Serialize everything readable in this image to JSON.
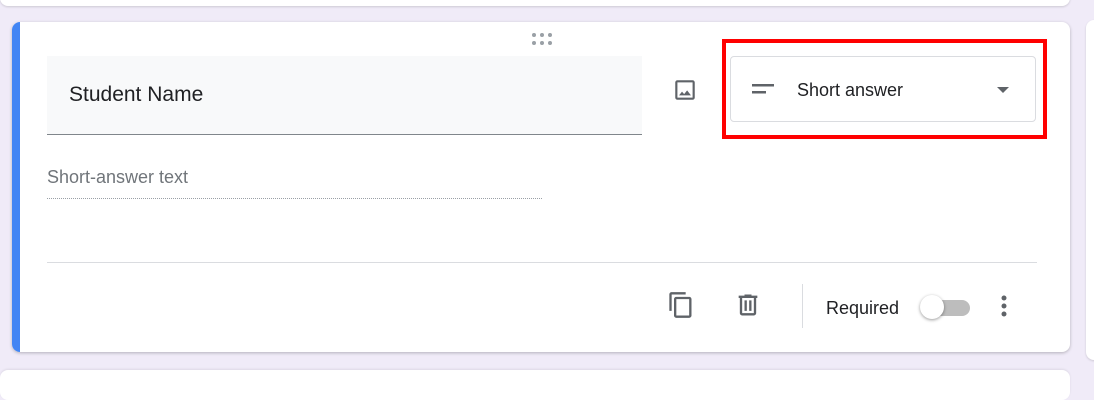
{
  "question": {
    "title": "Student Name",
    "answer_placeholder": "Short-answer text"
  },
  "type_select": {
    "selected": "Short answer",
    "icon": "short-text-icon"
  },
  "toolbar": {
    "required_label": "Required",
    "required_on": false
  },
  "icons": {
    "drag": "drag-handle-icon",
    "image": "image-icon",
    "duplicate": "copy-icon",
    "delete": "trash-icon",
    "more": "more-vert-icon"
  },
  "colors": {
    "accent": "#4285f4",
    "highlight": "#ff0000",
    "background": "#f0ebf8"
  }
}
